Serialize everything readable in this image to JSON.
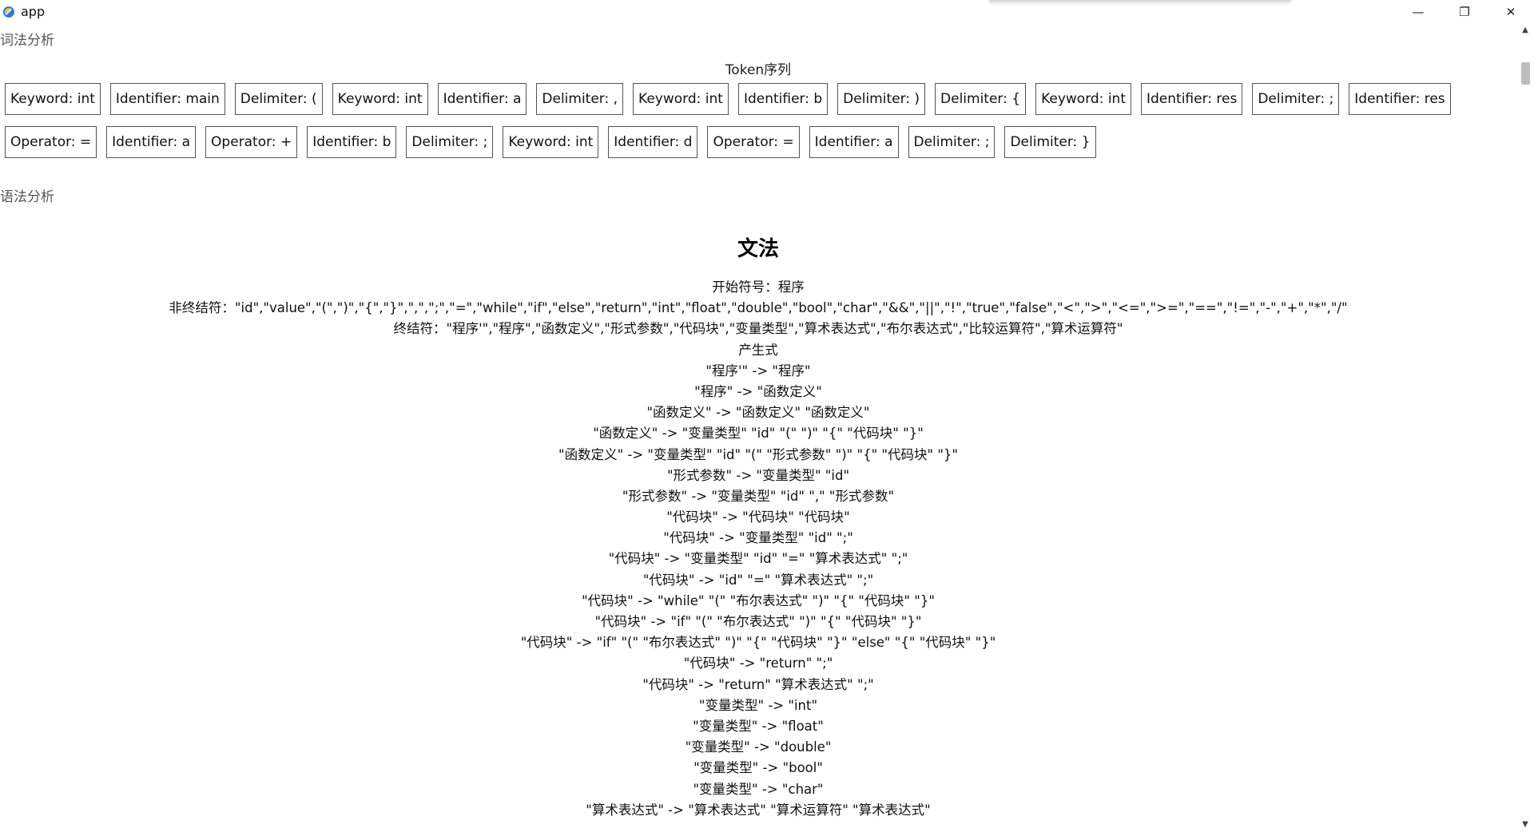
{
  "window": {
    "title": "app",
    "minimize_glyph": "—",
    "maximize_glyph": "❐",
    "close_glyph": "✕"
  },
  "lexical": {
    "section_label": "词法分析",
    "heading": "Token序列",
    "rows": [
      [
        "Keyword: int",
        "Identifier: main",
        "Delimiter: (",
        "Keyword: int",
        "Identifier: a",
        "Delimiter: ,",
        "Keyword: int",
        "Identifier: b",
        "Delimiter: )",
        "Delimiter: {",
        "Keyword: int",
        "Identifier: res",
        "Delimiter: ;",
        "Identifier: res"
      ],
      [
        "Operator: =",
        "Identifier: a",
        "Operator: +",
        "Identifier: b",
        "Delimiter: ;",
        "Keyword: int",
        "Identifier: d",
        "Operator: =",
        "Identifier: a",
        "Delimiter: ;",
        "Delimiter: }"
      ]
    ]
  },
  "syntax": {
    "section_label": "语法分析",
    "grammar_title": "文法",
    "lines": [
      "开始符号：程序",
      "非终结符：\"id\",\"value\",\"(\",\")\",\"{\",\"}\",\",\",\";\",\"=\",\"while\",\"if\",\"else\",\"return\",\"int\",\"float\",\"double\",\"bool\",\"char\",\"&&\",\"||\",\"!\",\"true\",\"false\",\"<\",\">\",\"<=\",\">=\",\"==\",\"!=\",\"-\",\"+\",\"*\",\"/\"",
      "终结符：\"程序'\",\"程序\",\"函数定义\",\"形式参数\",\"代码块\",\"变量类型\",\"算术表达式\",\"布尔表达式\",\"比较运算符\",\"算术运算符\"",
      "产生式",
      "\"程序'\" -> \"程序\"",
      "\"程序\" -> \"函数定义\"",
      "\"函数定义\" -> \"函数定义\" \"函数定义\"",
      "\"函数定义\" -> \"变量类型\" \"id\" \"(\" \")\" \"{\" \"代码块\" \"}\"",
      "\"函数定义\" -> \"变量类型\" \"id\" \"(\" \"形式参数\" \")\" \"{\" \"代码块\" \"}\"",
      "\"形式参数\" -> \"变量类型\" \"id\"",
      "\"形式参数\" -> \"变量类型\" \"id\" \",\" \"形式参数\"",
      "\"代码块\" -> \"代码块\" \"代码块\"",
      "\"代码块\" -> \"变量类型\" \"id\" \";\"",
      "\"代码块\" -> \"变量类型\" \"id\" \"=\" \"算术表达式\" \";\"",
      "\"代码块\" -> \"id\" \"=\" \"算术表达式\" \";\"",
      "\"代码块\" -> \"while\" \"(\" \"布尔表达式\" \")\" \"{\" \"代码块\" \"}\"",
      "\"代码块\" -> \"if\" \"(\" \"布尔表达式\" \")\" \"{\" \"代码块\" \"}\"",
      "\"代码块\" -> \"if\" \"(\" \"布尔表达式\" \")\" \"{\" \"代码块\" \"}\" \"else\" \"{\" \"代码块\" \"}\"",
      "\"代码块\" -> \"return\" \";\"",
      "\"代码块\" -> \"return\" \"算术表达式\" \";\"",
      "\"变量类型\" -> \"int\"",
      "\"变量类型\" -> \"float\"",
      "\"变量类型\" -> \"double\"",
      "\"变量类型\" -> \"bool\"",
      "\"变量类型\" -> \"char\"",
      "\"算术表达式\" -> \"算术表达式\" \"算术运算符\" \"算术表达式\""
    ]
  },
  "colors": {
    "background": "#ffffff",
    "token_border": "#555555",
    "section_label": "#555555"
  }
}
